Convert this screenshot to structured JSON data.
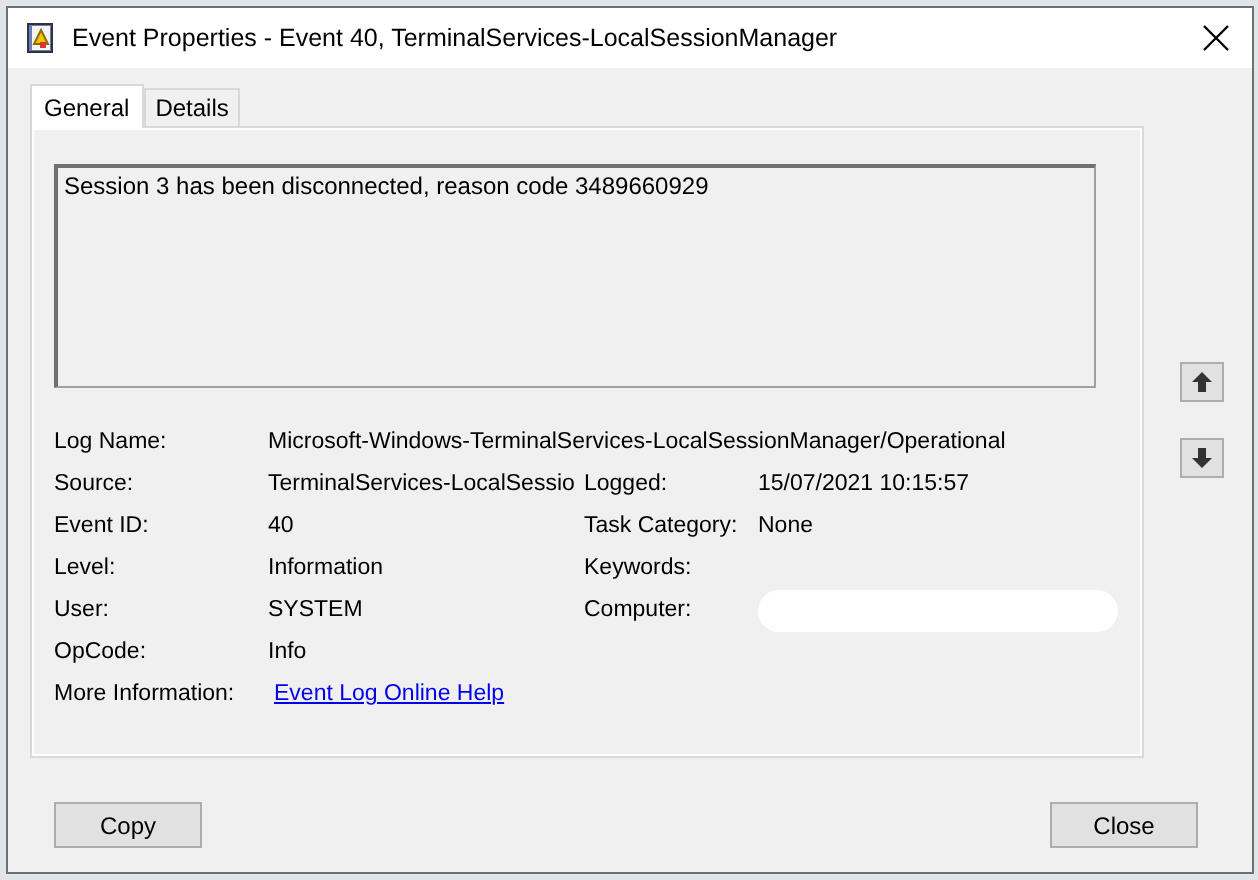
{
  "window": {
    "title": "Event Properties - Event 40, TerminalServices-LocalSessionManager"
  },
  "tabs": [
    {
      "label": "General",
      "selected": true
    },
    {
      "label": "Details",
      "selected": false
    }
  ],
  "description": "Session 3 has been disconnected, reason code 3489660929",
  "rows": [
    {
      "left": {
        "label": "Log Name:",
        "value": "Microsoft-Windows-TerminalServices-LocalSessionManager/Operational",
        "kind": "wide"
      }
    },
    {
      "left": {
        "label": "Source:",
        "value": "TerminalServices-LocalSessio",
        "kind": "text"
      },
      "right": {
        "label": "Logged:",
        "value": "15/07/2021 10:15:57",
        "kind": "text"
      }
    },
    {
      "left": {
        "label": "Event ID:",
        "value": "40",
        "kind": "text"
      },
      "right": {
        "label": "Task Category:",
        "value": "None",
        "kind": "text"
      }
    },
    {
      "left": {
        "label": "Level:",
        "value": "Information",
        "kind": "text"
      },
      "right": {
        "label": "Keywords:",
        "kind": "empty"
      }
    },
    {
      "left": {
        "label": "User:",
        "value": "SYSTEM",
        "kind": "text"
      },
      "right": {
        "label": "Computer:",
        "kind": "redacted"
      }
    },
    {
      "left": {
        "label": "OpCode:",
        "value": "Info",
        "kind": "text"
      }
    },
    {
      "left": {
        "label": "More Information:",
        "value": "Event Log Online Help",
        "kind": "link"
      }
    }
  ],
  "buttons": [
    "Copy",
    "Close"
  ]
}
